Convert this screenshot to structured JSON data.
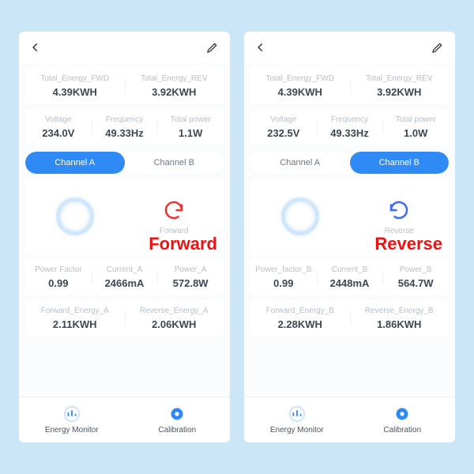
{
  "left": {
    "totals": {
      "fwd_lbl": "Total_Energy_FWD",
      "fwd_val": "4.39KWH",
      "rev_lbl": "Total_Energy_REV",
      "rev_val": "3.92KWH"
    },
    "row2": {
      "volt_lbl": "Voltage",
      "volt_val": "234.0V",
      "freq_lbl": "Frequency",
      "freq_val": "49.33Hz",
      "tp_lbl": "Total power",
      "tp_val": "1.1W"
    },
    "tabs": {
      "a": "Channel A",
      "b": "Channel B",
      "active": "a"
    },
    "direction": {
      "word": "Forward",
      "small": "Forward"
    },
    "row3": {
      "pf_lbl": "Power Factor",
      "pf_val": "0.99",
      "cur_lbl": "Current_A",
      "cur_val": "2466mA",
      "pow_lbl": "Power_A",
      "pow_val": "572.8W"
    },
    "row4": {
      "fe_lbl": "Forward_Energy_A",
      "fe_val": "2.11KWH",
      "re_lbl": "Reverse_Energy_A",
      "re_val": "2.06KWH"
    },
    "nav": {
      "a": "Energy Monitor",
      "b": "Calibration"
    }
  },
  "right": {
    "totals": {
      "fwd_lbl": "Total_Energy_FWD",
      "fwd_val": "4.39KWH",
      "rev_lbl": "Total_Energy_REV",
      "rev_val": "3.92KWH"
    },
    "row2": {
      "volt_lbl": "Voltage",
      "volt_val": "232.5V",
      "freq_lbl": "Frequency",
      "freq_val": "49.33Hz",
      "tp_lbl": "Total power",
      "tp_val": "1.0W"
    },
    "tabs": {
      "a": "Channel A",
      "b": "Channel B",
      "active": "b"
    },
    "direction": {
      "word": "Reverse",
      "small": "Reverse"
    },
    "row3": {
      "pf_lbl": "Power_factor_B",
      "pf_val": "0.99",
      "cur_lbl": "Current_B",
      "cur_val": "2448mA",
      "pow_lbl": "Power_B",
      "pow_val": "564.7W"
    },
    "row4": {
      "fe_lbl": "Forward_Energy_B",
      "fe_val": "2.28KWH",
      "re_lbl": "Reverse_Energy_B",
      "re_val": "1.86KWH"
    },
    "nav": {
      "a": "Energy Monitor",
      "b": "Calibration"
    }
  }
}
